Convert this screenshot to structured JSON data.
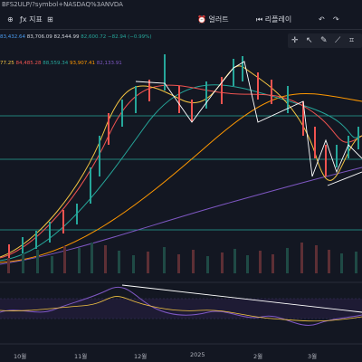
{
  "topbar": {
    "symbol_text": "BFS2ULP/?symbol+NASDAQ%3ANVDA"
  },
  "toolbar": {
    "indicators_label": "지표",
    "replay_label": "리플레이",
    "alert_label": "얼러트"
  },
  "ohlc": {
    "values": [
      "83,432.64",
      "83,706.09",
      "82,544.99",
      "82,600.72",
      "−82.94 (−0.99%)"
    ],
    "colors": [
      "#4a9cf0",
      "#d1d4dc",
      "#d1d4dc",
      "#26a69a",
      "#26a69a"
    ]
  },
  "moving_averages": {
    "values": [
      "77.25",
      "84,485.28",
      "88,559.34",
      "93,907.41",
      "82,133.91"
    ],
    "colors": [
      "#f5c542",
      "#ef5350",
      "#26a69a",
      "#ff9800",
      "#7e57c2"
    ]
  },
  "x_axis": {
    "labels": [
      "10월",
      "11월",
      "12월",
      "2025",
      "2월",
      "3월"
    ]
  },
  "drawing_tools": {
    "icons": [
      "crosshair-icon",
      "arrow-icon",
      "pencil-icon",
      "trendline-icon",
      "ruler-icon"
    ]
  }
}
